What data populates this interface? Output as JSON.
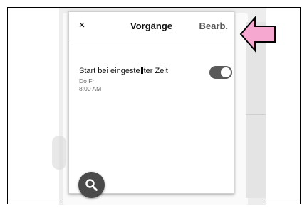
{
  "header": {
    "close_label": "×",
    "title": "Vorgänge",
    "edit_label": "Bearb."
  },
  "routine": {
    "title_before_cursor": "Start bei eingeste",
    "title_after_cursor": "ter Zeit",
    "days": "Do Fr",
    "time": "8:00 AM",
    "enabled": true
  },
  "icons": {
    "fab": "search-icon",
    "pointer": "arrow-left-icon"
  },
  "colors": {
    "toggle_on": "#595959",
    "fab": "#4a4a4a",
    "pointer_fill": "#f7a8d0"
  }
}
